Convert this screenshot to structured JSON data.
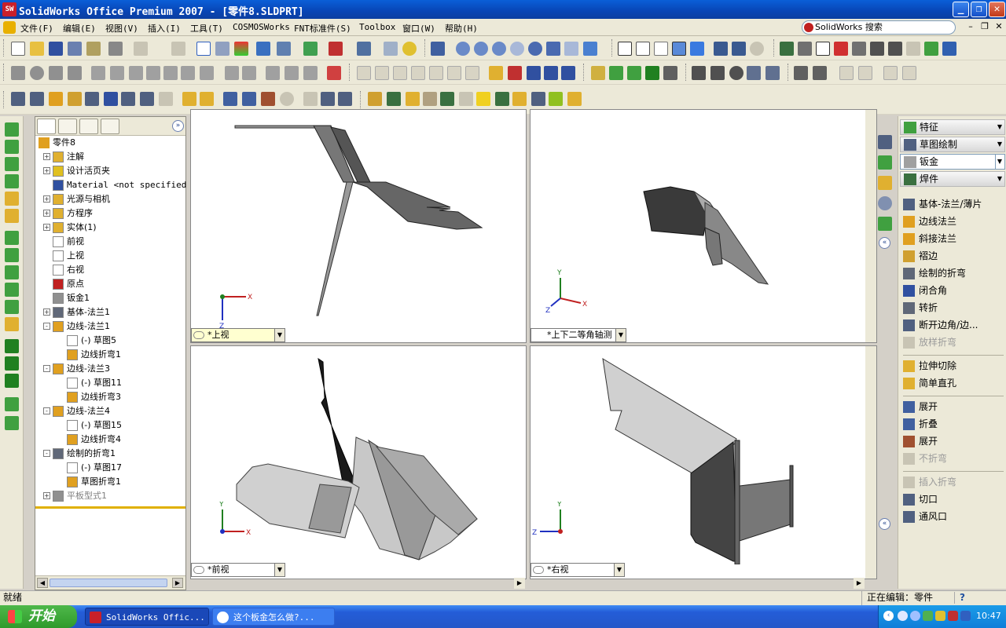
{
  "window": {
    "title": "SolidWorks Office Premium 2007 - [零件8.SLDPRT]",
    "app_icon": "SW"
  },
  "menu": {
    "items": [
      "文件(F)",
      "编辑(E)",
      "视图(V)",
      "插入(I)",
      "工具(T)",
      "COSMOSWorks",
      "FNT标准件(S)",
      "Toolbox",
      "窗口(W)",
      "帮助(H)"
    ],
    "search_label": "SolidWorks 搜索"
  },
  "tree": {
    "root": "零件8",
    "items": [
      {
        "label": "注解",
        "indent": 0,
        "exp": "+",
        "icon": "annotation-icon"
      },
      {
        "label": "设计活页夹",
        "indent": 0,
        "exp": "+",
        "icon": "design-binder-icon"
      },
      {
        "label": "Material <not specified>",
        "indent": 0,
        "exp": "",
        "icon": "material-icon"
      },
      {
        "label": "光源与相机",
        "indent": 0,
        "exp": "+",
        "icon": "lights-cameras-icon"
      },
      {
        "label": "方程序",
        "indent": 0,
        "exp": "+",
        "icon": "equations-icon"
      },
      {
        "label": "实体(1)",
        "indent": 0,
        "exp": "+",
        "icon": "solid-bodies-icon"
      },
      {
        "label": "前视",
        "indent": 0,
        "exp": "",
        "icon": "plane-icon"
      },
      {
        "label": "上视",
        "indent": 0,
        "exp": "",
        "icon": "plane-icon"
      },
      {
        "label": "右视",
        "indent": 0,
        "exp": "",
        "icon": "plane-icon"
      },
      {
        "label": "原点",
        "indent": 0,
        "exp": "",
        "icon": "origin-icon"
      },
      {
        "label": "钣金1",
        "indent": 0,
        "exp": "",
        "icon": "sheet-metal-icon"
      },
      {
        "label": "基体-法兰1",
        "indent": 0,
        "exp": "+",
        "icon": "base-flange-icon"
      },
      {
        "label": "边线-法兰1",
        "indent": 0,
        "exp": "-",
        "icon": "edge-flange-icon"
      },
      {
        "label": "(-) 草图5",
        "indent": 1,
        "exp": "",
        "icon": "sketch-icon"
      },
      {
        "label": "边线折弯1",
        "indent": 1,
        "exp": "",
        "icon": "bend-icon"
      },
      {
        "label": "边线-法兰3",
        "indent": 0,
        "exp": "-",
        "icon": "edge-flange-icon"
      },
      {
        "label": "(-) 草图11",
        "indent": 1,
        "exp": "",
        "icon": "sketch-icon"
      },
      {
        "label": "边线折弯3",
        "indent": 1,
        "exp": "",
        "icon": "bend-icon"
      },
      {
        "label": "边线-法兰4",
        "indent": 0,
        "exp": "-",
        "icon": "edge-flange-icon"
      },
      {
        "label": "(-) 草图15",
        "indent": 1,
        "exp": "",
        "icon": "sketch-icon"
      },
      {
        "label": "边线折弯4",
        "indent": 1,
        "exp": "",
        "icon": "bend-icon"
      },
      {
        "label": "绘制的折弯1",
        "indent": 0,
        "exp": "-",
        "icon": "sketched-bend-icon"
      },
      {
        "label": "(-) 草图17",
        "indent": 1,
        "exp": "",
        "icon": "sketch-icon"
      },
      {
        "label": "草图折弯1",
        "indent": 1,
        "exp": "",
        "icon": "bend-icon"
      },
      {
        "label": "平板型式1",
        "indent": 0,
        "exp": "+",
        "icon": "flat-pattern-icon",
        "disabled": true
      }
    ]
  },
  "viewports": [
    {
      "view": "*上视"
    },
    {
      "view": "*上下二等角轴测"
    },
    {
      "view": "*前视"
    },
    {
      "view": "*右视"
    }
  ],
  "axes": {
    "x": "X",
    "y": "Y",
    "z": "Z"
  },
  "command_manager": {
    "headers": [
      "特征",
      "草图绘制",
      "钣金",
      "焊件"
    ],
    "active_header": "钣金",
    "items": [
      {
        "label": "基体-法兰/薄片",
        "disabled": false,
        "group": 0
      },
      {
        "label": "边线法兰",
        "disabled": false,
        "group": 0
      },
      {
        "label": "斜接法兰",
        "disabled": false,
        "group": 0
      },
      {
        "label": "褶边",
        "disabled": false,
        "group": 0
      },
      {
        "label": "绘制的折弯",
        "disabled": false,
        "group": 0
      },
      {
        "label": "闭合角",
        "disabled": false,
        "group": 0
      },
      {
        "label": "转折",
        "disabled": false,
        "group": 0
      },
      {
        "label": "断开边角/边...",
        "disabled": false,
        "group": 0
      },
      {
        "label": "放样折弯",
        "disabled": true,
        "group": 0
      },
      {
        "label": "拉伸切除",
        "disabled": false,
        "group": 1
      },
      {
        "label": "简单直孔",
        "disabled": false,
        "group": 1
      },
      {
        "label": "展开",
        "disabled": false,
        "group": 2
      },
      {
        "label": "折叠",
        "disabled": false,
        "group": 2
      },
      {
        "label": "展开",
        "disabled": false,
        "group": 2
      },
      {
        "label": "不折弯",
        "disabled": true,
        "group": 2
      },
      {
        "label": "插入折弯",
        "disabled": true,
        "group": 3
      },
      {
        "label": "切口",
        "disabled": false,
        "group": 3
      },
      {
        "label": "通风口",
        "disabled": false,
        "group": 3
      }
    ]
  },
  "status": {
    "left": "就绪",
    "right": "正在编辑：零件",
    "help": "?"
  },
  "taskbar": {
    "start": "开始",
    "tasks": [
      "SolidWorks Offic...",
      "这个板金怎么做?..."
    ],
    "clock": "10:47"
  }
}
